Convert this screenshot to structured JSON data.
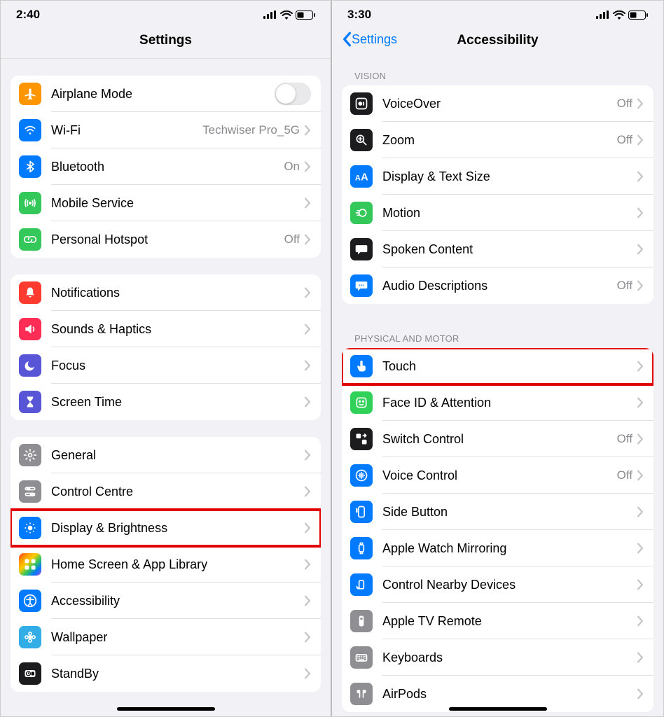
{
  "left": {
    "status_time": "2:40",
    "header_title": "Settings",
    "groups": [
      {
        "items": [
          {
            "name": "airplane-mode",
            "icon": "airplane",
            "iconBg": "bg-orange",
            "label": "Airplane Mode",
            "control": "toggle"
          },
          {
            "name": "wifi",
            "icon": "wifi",
            "iconBg": "bg-blue",
            "label": "Wi-Fi",
            "value": "Techwiser Pro_5G",
            "chevron": true
          },
          {
            "name": "bluetooth",
            "icon": "bluetooth",
            "iconBg": "bg-blue",
            "label": "Bluetooth",
            "value": "On",
            "chevron": true
          },
          {
            "name": "mobile-service",
            "icon": "antenna",
            "iconBg": "bg-green",
            "label": "Mobile Service",
            "chevron": true
          },
          {
            "name": "personal-hotspot",
            "icon": "link",
            "iconBg": "bg-green",
            "label": "Personal Hotspot",
            "value": "Off",
            "chevron": true
          }
        ]
      },
      {
        "items": [
          {
            "name": "notifications",
            "icon": "bell",
            "iconBg": "bg-red",
            "label": "Notifications",
            "chevron": true
          },
          {
            "name": "sounds-haptics",
            "icon": "speaker",
            "iconBg": "bg-pink",
            "label": "Sounds & Haptics",
            "chevron": true
          },
          {
            "name": "focus",
            "icon": "moon",
            "iconBg": "bg-indigo",
            "label": "Focus",
            "chevron": true
          },
          {
            "name": "screen-time",
            "icon": "hourglass",
            "iconBg": "bg-indigo",
            "label": "Screen Time",
            "chevron": true
          }
        ]
      },
      {
        "items": [
          {
            "name": "general",
            "icon": "gear",
            "iconBg": "bg-gray",
            "label": "General",
            "chevron": true
          },
          {
            "name": "control-centre",
            "icon": "sliders",
            "iconBg": "bg-gray",
            "label": "Control Centre",
            "chevron": true
          },
          {
            "name": "display-brightness",
            "icon": "sun",
            "iconBg": "bg-blue",
            "label": "Display & Brightness",
            "chevron": true,
            "highlight": true
          },
          {
            "name": "home-screen",
            "icon": "grid",
            "iconBg": "bg-gradient",
            "label": "Home Screen & App Library",
            "chevron": true
          },
          {
            "name": "accessibility",
            "icon": "accessibility",
            "iconBg": "bg-blue",
            "label": "Accessibility",
            "chevron": true
          },
          {
            "name": "wallpaper",
            "icon": "flower",
            "iconBg": "bg-cyan",
            "label": "Wallpaper",
            "chevron": true
          },
          {
            "name": "standby",
            "icon": "clock",
            "iconBg": "bg-black",
            "label": "StandBy",
            "chevron": true
          }
        ]
      }
    ]
  },
  "right": {
    "status_time": "3:30",
    "back_label": "Settings",
    "header_title": "Accessibility",
    "sections": [
      {
        "header": "VISION",
        "items": [
          {
            "name": "voiceover",
            "icon": "voiceover",
            "iconBg": "bg-black",
            "label": "VoiceOver",
            "value": "Off",
            "chevron": true
          },
          {
            "name": "zoom",
            "icon": "zoom",
            "iconBg": "bg-black",
            "label": "Zoom",
            "value": "Off",
            "chevron": true
          },
          {
            "name": "display-text-size",
            "icon": "aa",
            "iconBg": "bg-blue",
            "label": "Display & Text Size",
            "chevron": true
          },
          {
            "name": "motion",
            "icon": "motion",
            "iconBg": "bg-green",
            "label": "Motion",
            "chevron": true
          },
          {
            "name": "spoken-content",
            "icon": "speech",
            "iconBg": "bg-black",
            "label": "Spoken Content",
            "chevron": true
          },
          {
            "name": "audio-descriptions",
            "icon": "ad",
            "iconBg": "bg-blue",
            "label": "Audio Descriptions",
            "value": "Off",
            "chevron": true
          }
        ]
      },
      {
        "header": "PHYSICAL AND MOTOR",
        "items": [
          {
            "name": "touch",
            "icon": "touch",
            "iconBg": "bg-blue",
            "label": "Touch",
            "chevron": true,
            "highlight": true
          },
          {
            "name": "face-id-attention",
            "icon": "face",
            "iconBg": "bg-green2",
            "label": "Face ID & Attention",
            "chevron": true
          },
          {
            "name": "switch-control",
            "icon": "switch",
            "iconBg": "bg-black",
            "label": "Switch Control",
            "value": "Off",
            "chevron": true
          },
          {
            "name": "voice-control",
            "icon": "voicectl",
            "iconBg": "bg-blue",
            "label": "Voice Control",
            "value": "Off",
            "chevron": true
          },
          {
            "name": "side-button",
            "icon": "sidebtn",
            "iconBg": "bg-blue",
            "label": "Side Button",
            "chevron": true
          },
          {
            "name": "apple-watch-mirroring",
            "icon": "watch",
            "iconBg": "bg-blue",
            "label": "Apple Watch Mirroring",
            "chevron": true
          },
          {
            "name": "control-nearby",
            "icon": "nearby",
            "iconBg": "bg-blue",
            "label": "Control Nearby Devices",
            "chevron": true
          },
          {
            "name": "apple-tv-remote",
            "icon": "remote",
            "iconBg": "bg-gray",
            "label": "Apple TV Remote",
            "chevron": true
          },
          {
            "name": "keyboards",
            "icon": "keyboard",
            "iconBg": "bg-gray",
            "label": "Keyboards",
            "chevron": true
          },
          {
            "name": "airpods",
            "icon": "airpods",
            "iconBg": "bg-gray",
            "label": "AirPods",
            "chevron": true
          }
        ]
      }
    ]
  }
}
